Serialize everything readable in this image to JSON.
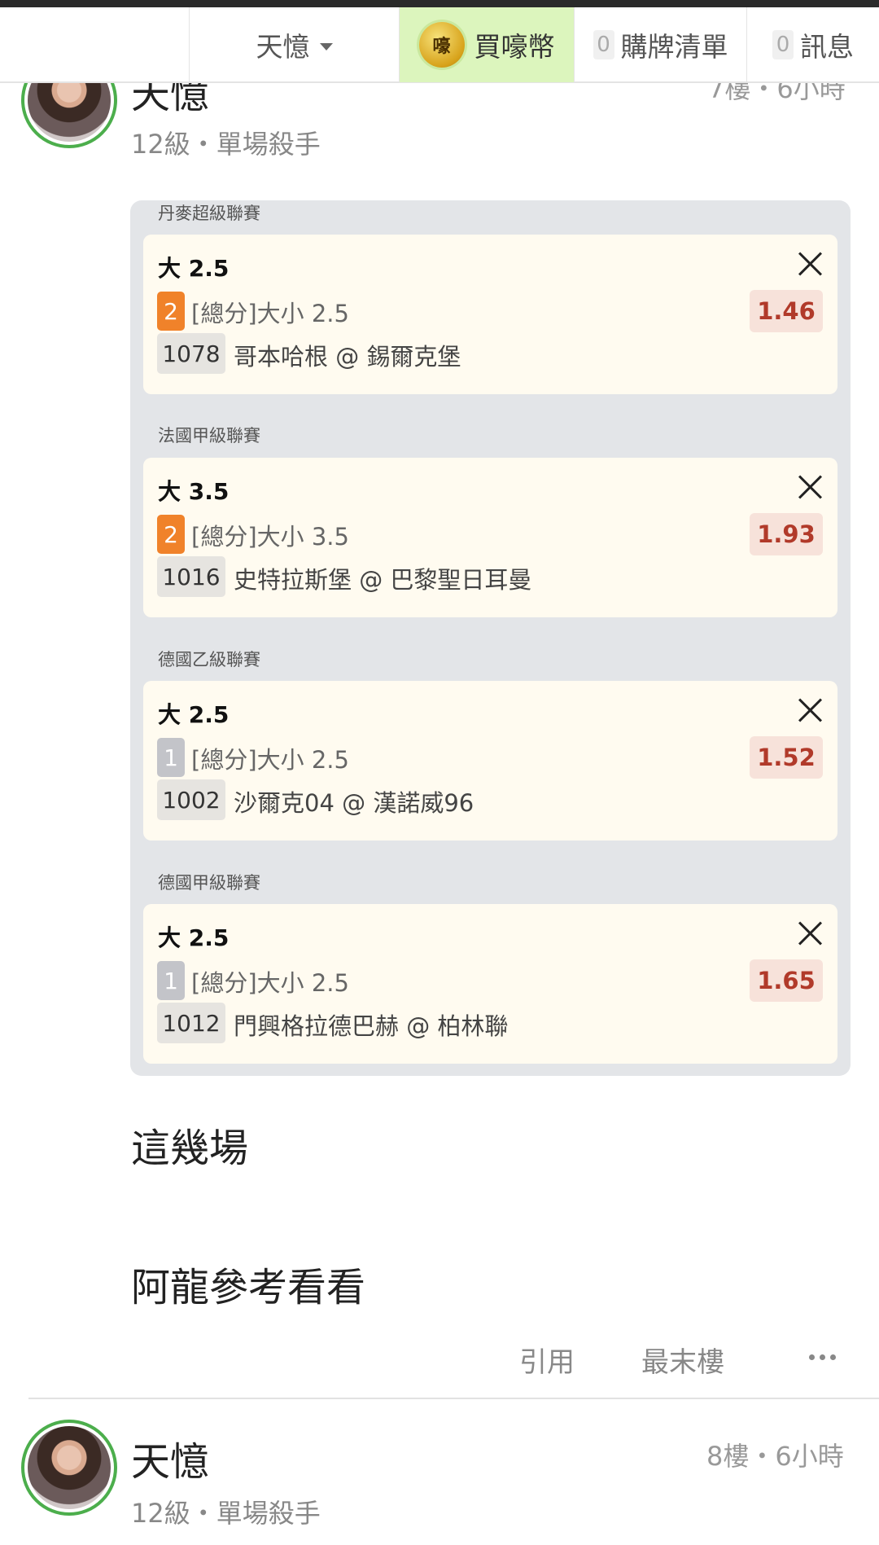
{
  "topbar": {
    "username": "天憶",
    "buy_label": "買嚎幣",
    "coin_glyph": "嚎",
    "list_count": "0",
    "list_label": "購牌清單",
    "msg_count": "0",
    "msg_label": "訊息"
  },
  "post1": {
    "name": "天憶",
    "level": "12級・單場殺手",
    "meta": "7樓・6小時"
  },
  "panel": {
    "groups": [
      {
        "league": "丹麥超級聯賽",
        "title": "大 2.5",
        "badge": "2",
        "market": "[總分]大小 2.5",
        "odds": "1.46",
        "game_no": "1078",
        "teams": "哥本哈根 @ 錫爾克堡"
      },
      {
        "league": "法國甲級聯賽",
        "title": "大 3.5",
        "badge": "2",
        "market": "[總分]大小 3.5",
        "odds": "1.93",
        "game_no": "1016",
        "teams": "史特拉斯堡 @ 巴黎聖日耳曼"
      },
      {
        "league": "德國乙級聯賽",
        "title": "大 2.5",
        "badge": "1",
        "market": "[總分]大小 2.5",
        "odds": "1.52",
        "game_no": "1002",
        "teams": "沙爾克04 @ 漢諾威96"
      },
      {
        "league": "德國甲級聯賽",
        "title": "大 2.5",
        "badge": "1",
        "market": "[總分]大小 2.5",
        "odds": "1.65",
        "game_no": "1012",
        "teams": "門興格拉德巴赫 @ 柏林聯"
      }
    ]
  },
  "body_text": {
    "line1": "這幾場",
    "line2": "阿龍參考看看"
  },
  "actions": {
    "quote": "引用",
    "last_floor": "最末樓"
  },
  "post2": {
    "name": "天憶",
    "level": "12級・單場殺手",
    "meta": "8樓・6小時"
  },
  "colors": {
    "accent_green": "#4cae4c",
    "buy_bg": "#dcf5bd",
    "badge_orange": "#f0822a",
    "badge_grey": "#c3c4c9",
    "odds_text": "#b13a2a"
  }
}
